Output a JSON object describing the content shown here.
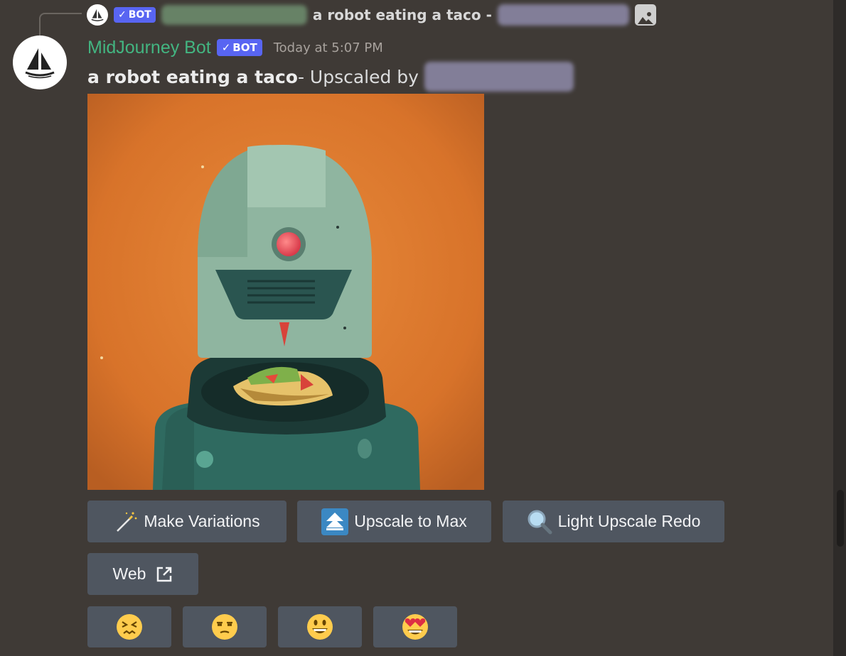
{
  "reply": {
    "bot_tag": "BOT",
    "text": "a robot eating a taco -"
  },
  "message": {
    "username": "MidJourney Bot",
    "bot_tag": "BOT",
    "timestamp": "Today at 5:07 PM",
    "prompt": "a robot eating a taco",
    "suffix": " - Upscaled by"
  },
  "buttons": {
    "make_variations": "Make Variations",
    "upscale_to_max": "Upscale to Max",
    "light_upscale_redo": "Light Upscale Redo",
    "web": "Web"
  },
  "reactions": [
    {
      "icon": "confounded-face-icon"
    },
    {
      "icon": "unamused-face-icon"
    },
    {
      "icon": "grinning-face-icon"
    },
    {
      "icon": "heart-eyes-face-icon"
    }
  ],
  "colors": {
    "background": "#3f3a36",
    "username": "#43b581",
    "bot_tag": "#5865f2",
    "button": "#4f5660"
  }
}
